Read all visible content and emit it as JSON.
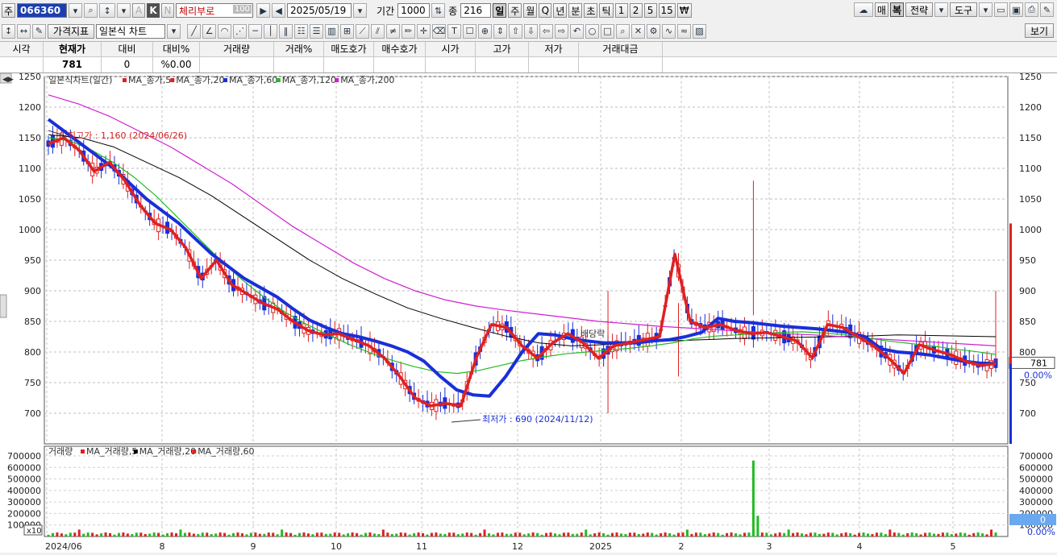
{
  "toolbar1": {
    "market_label": "주",
    "code": "066360",
    "name": "체리부로",
    "name_badge": "100",
    "date": "2025/05/19",
    "period_label": "기간",
    "period_value": "1000",
    "count_label": "종",
    "count_value": "216",
    "intervals": [
      "일",
      "주",
      "월",
      "Q",
      "년",
      "분",
      "초",
      "틱",
      "1",
      "2",
      "5",
      "15"
    ],
    "selected_interval": "일",
    "k_label": "K",
    "a_label": "A",
    "n_label": "N",
    "right_buttons": [
      "매",
      "복",
      "전략",
      "도구"
    ]
  },
  "toolbar2": {
    "indicator_button": "가격지표",
    "chart_type": "일본식 차트",
    "view_button": "보기"
  },
  "quote": {
    "headers": [
      "시각",
      "현재가",
      "대비",
      "대비%",
      "거래량",
      "거래%",
      "매도호가",
      "매수호가",
      "시가",
      "고가",
      "저가",
      "거래대금"
    ],
    "values": [
      "",
      "781",
      "0",
      "%0.00",
      "",
      "",
      "",
      "",
      "",
      "",
      "",
      ""
    ]
  },
  "chart_data": {
    "type": "line",
    "price_panel": {
      "legend": {
        "title": "일본식차트(일간)",
        "items": [
          {
            "name": "MA_종가,5",
            "color": "#e02020"
          },
          {
            "name": "MA_종가,20",
            "color": "#e02020"
          },
          {
            "name": "MA_종가,60",
            "color": "#1a2fd8"
          },
          {
            "name": "MA_종가,120",
            "color": "#22bb22"
          },
          {
            "name": "MA_종가,200",
            "color": "#d020d0"
          }
        ]
      },
      "ylim": [
        650,
        1250
      ],
      "yticks": [
        700,
        750,
        800,
        850,
        900,
        950,
        1000,
        1050,
        1100,
        1150,
        1200,
        1250
      ],
      "current_price": "781",
      "current_change": "0.00%",
      "annotations": {
        "high": "최고가 : 1,160 (2024/06/26)",
        "low": "최저가 : 690 (2024/11/12)",
        "dividend": "배당락"
      },
      "x": [
        0,
        5,
        10,
        15,
        20,
        25,
        30,
        35,
        40,
        45,
        50,
        55,
        60,
        65,
        70,
        75,
        80,
        85,
        90,
        95,
        100,
        105,
        110,
        115,
        120,
        125,
        130,
        135,
        140,
        145,
        150,
        155,
        160,
        165,
        170,
        175,
        180,
        185,
        190,
        195,
        200,
        205,
        210,
        215
      ],
      "series": [
        {
          "name": "MA_종가,5",
          "color": "#e02020",
          "width": 3.5,
          "values": [
            1140,
            1150,
            1130,
            1095,
            1110,
            1080,
            1040,
            1010,
            1000,
            970,
            920,
            950,
            910,
            895,
            880,
            870,
            850,
            835,
            828,
            830,
            820,
            810,
            790,
            760,
            725,
            712,
            716,
            712,
            790,
            845,
            840,
            810,
            790,
            815,
            830,
            815,
            790,
            810,
            815,
            820,
            825,
            960,
            850,
            840,
            845,
            835,
            830,
            832,
            825,
            818,
            790,
            845,
            840,
            825,
            810,
            790,
            765,
            812,
            803,
            796,
            785,
            778,
            781
          ]
        },
        {
          "name": "MA_종가,60",
          "color": "#1a2fd8",
          "width": 4,
          "values": [
            1180,
            1160,
            1140,
            1120,
            1100,
            1075,
            1050,
            1030,
            1010,
            985,
            960,
            940,
            920,
            905,
            890,
            870,
            852,
            840,
            830,
            825,
            818,
            810,
            800,
            785,
            760,
            738,
            730,
            728,
            760,
            800,
            830,
            828,
            822,
            818,
            815,
            815,
            815,
            818,
            820,
            825,
            832,
            855,
            850,
            848,
            845,
            842,
            840,
            838,
            835,
            832,
            825,
            805,
            800,
            798,
            795,
            790,
            785,
            782,
            781
          ]
        },
        {
          "name": "MA_종가,120",
          "color": "#22bb22",
          "width": 1.2,
          "values": [
            1150,
            1145,
            1130,
            1110,
            1085,
            1055,
            1020,
            985,
            950,
            918,
            890,
            865,
            845,
            828,
            812,
            798,
            786,
            776,
            768,
            765,
            770,
            778,
            786,
            792,
            797,
            800,
            803,
            806,
            810,
            815,
            822,
            826,
            828,
            830,
            832,
            833,
            831,
            828,
            823,
            818,
            814,
            810,
            805,
            801,
            796
          ]
        },
        {
          "name": "MA_종가,200",
          "color": "#d020d0",
          "width": 1.2,
          "values": [
            1220,
            1205,
            1185,
            1160,
            1135,
            1105,
            1075,
            1040,
            1005,
            975,
            945,
            920,
            900,
            885,
            875,
            868,
            862,
            856,
            850,
            846,
            842,
            839,
            836,
            833,
            830,
            828,
            825,
            822,
            819,
            816,
            813,
            810
          ]
        },
        {
          "name": "MA_종가,20",
          "color": "#000000",
          "width": 1,
          "values": [
            1155,
            1150,
            1135,
            1110,
            1085,
            1055,
            1020,
            985,
            950,
            920,
            895,
            872,
            855,
            840,
            826,
            815,
            810,
            812,
            815,
            818,
            820,
            822,
            823,
            824,
            825,
            826,
            828,
            827,
            826,
            825
          ]
        }
      ]
    },
    "volume_panel": {
      "legend": {
        "title": "거래량",
        "items": [
          {
            "name": "MA_거래량,5",
            "color": "#e02020"
          },
          {
            "name": "MA_거래량,20",
            "color": "#000000"
          },
          {
            "name": "MA_거래량,60",
            "color": "#e02020"
          }
        ]
      },
      "ylim": [
        0,
        700000
      ],
      "yticks": [
        100000,
        200000,
        300000,
        400000,
        500000,
        600000,
        700000
      ],
      "scale_label": "x10",
      "current_value": "0",
      "current_change": "0.00%",
      "spike_index": 160,
      "spike_value": 660000
    },
    "x_labels": [
      "2024/06",
      "8",
      "9",
      "10",
      "11",
      "12",
      "2025",
      "2",
      "3",
      "4",
      "5"
    ]
  }
}
